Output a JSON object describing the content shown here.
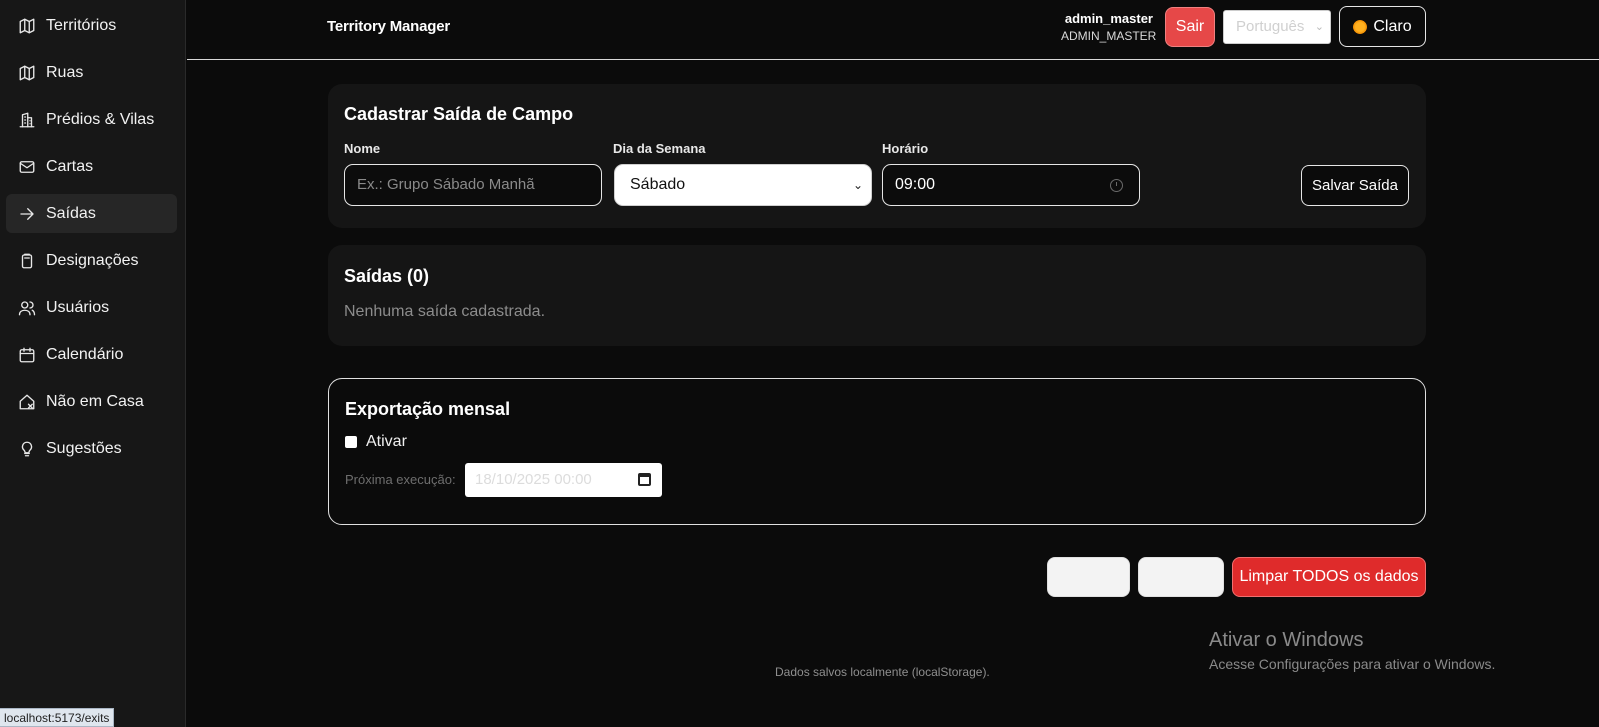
{
  "sidebar": {
    "items": [
      {
        "label": "Territórios",
        "icon": "map-icon"
      },
      {
        "label": "Ruas",
        "icon": "map-icon"
      },
      {
        "label": "Prédios & Vilas",
        "icon": "building-icon"
      },
      {
        "label": "Cartas",
        "icon": "mail-icon"
      },
      {
        "label": "Saídas",
        "icon": "arrow-right-icon",
        "active": true
      },
      {
        "label": "Designações",
        "icon": "clipboard-icon"
      },
      {
        "label": "Usuários",
        "icon": "users-icon"
      },
      {
        "label": "Calendário",
        "icon": "calendar-icon"
      },
      {
        "label": "Não em Casa",
        "icon": "house-x-icon"
      },
      {
        "label": "Sugestões",
        "icon": "lightbulb-icon"
      }
    ]
  },
  "status_url": "localhost:5173/exits",
  "header": {
    "brand": "Territory Manager",
    "user_name": "admin_master",
    "user_role": "ADMIN_MASTER",
    "logout_label": "Sair",
    "language_value": "Português",
    "theme_label": "Claro",
    "theme_icon": "sun-icon"
  },
  "form": {
    "title": "Cadastrar Saída de Campo",
    "name_label": "Nome",
    "name_placeholder": "Ex.: Grupo Sábado Manhã",
    "weekday_label": "Dia da Semana",
    "weekday_value": "Sábado",
    "time_label": "Horário",
    "time_value": "09:00",
    "save_label": "Salvar Saída"
  },
  "list": {
    "title": "Saídas (0)",
    "empty_text": "Nenhuma saída cadastrada."
  },
  "export": {
    "title": "Exportação mensal",
    "enable_label": "Ativar",
    "enabled": false,
    "next_run_label": "Próxima execução:",
    "next_run_value": "18/10/2025 00:00"
  },
  "actions": {
    "clear_all_label": "Limpar TODOS os dados"
  },
  "footer_note": "Dados salvos localmente (localStorage).",
  "windows_watermark": {
    "title": "Ativar o Windows",
    "subtitle": "Acesse Configurações para ativar o Windows."
  },
  "colors": {
    "accent_danger": "#df2b2b",
    "background": "#0b0b0b",
    "card": "#151515"
  }
}
